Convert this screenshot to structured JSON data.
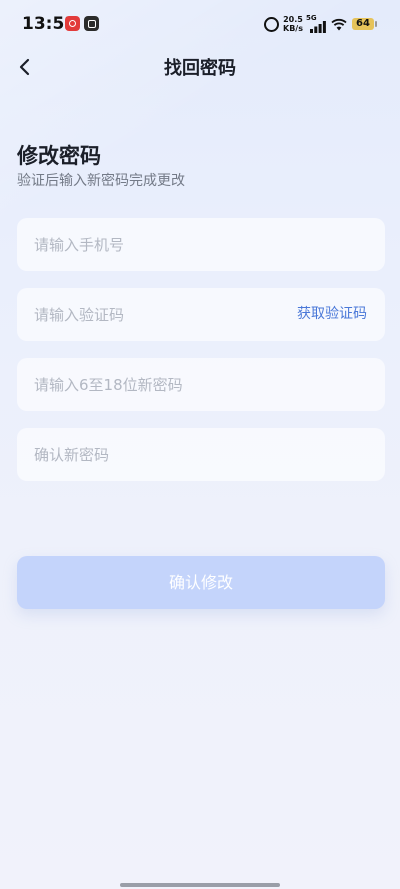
{
  "status_bar": {
    "time": "13:53",
    "net_speed_value": "20.5",
    "net_speed_unit": "KB/s",
    "network_type": "5G",
    "battery_level": "64",
    "icons": [
      "netease-music-icon",
      "app-icon",
      "alarm-icon",
      "signal-icon",
      "wifi-icon",
      "battery-icon"
    ]
  },
  "header": {
    "back_icon": "chevron-left-icon",
    "title": "找回密码"
  },
  "section": {
    "title": "修改密码",
    "subtitle": "验证后输入新密码完成更改"
  },
  "form": {
    "phone_placeholder": "请输入手机号",
    "phone_value": "",
    "code_placeholder": "请输入验证码",
    "code_value": "",
    "get_code_label": "获取验证码",
    "new_password_placeholder": "请输入6至18位新密码",
    "new_password_value": "",
    "confirm_password_placeholder": "确认新密码",
    "confirm_password_value": ""
  },
  "submit": {
    "label": "确认修改"
  },
  "colors": {
    "accent": "#4a78d8",
    "submit_disabled": "#c4d4fb",
    "placeholder": "#b3b8c3",
    "battery": "#e6c35a"
  }
}
